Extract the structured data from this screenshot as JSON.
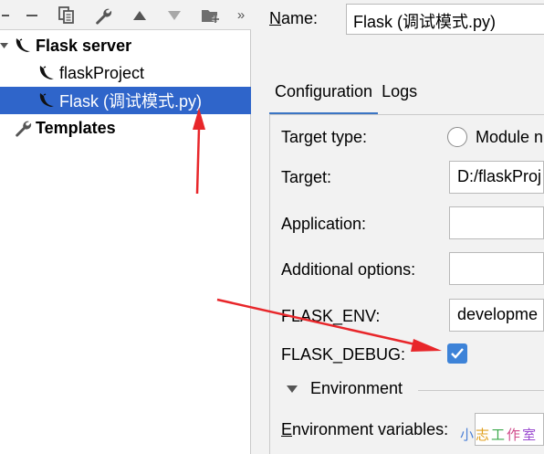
{
  "toolbar": {
    "buttons": [
      "add-icon",
      "remove-icon",
      "copy-icon",
      "wrench-icon",
      "move-up-icon",
      "move-down-icon",
      "new-folder-icon",
      "more-icon"
    ],
    "more_label": "»"
  },
  "tree": {
    "items": [
      {
        "label": "Flask server",
        "level": 0,
        "bold": true,
        "expanded": true,
        "icon": "flask-icon"
      },
      {
        "label": "flaskProject",
        "level": 1,
        "bold": false,
        "icon": "flask-icon"
      },
      {
        "label": "Flask (调试模式.py)",
        "level": 1,
        "bold": false,
        "selected": true,
        "icon": "flask-icon"
      },
      {
        "label": "Templates",
        "level": 0,
        "bold": true,
        "icon": "wrench-icon"
      }
    ]
  },
  "config": {
    "name_label_u": "N",
    "name_label_rest": "ame:",
    "name_value": "Flask (调试模式.py)",
    "tabs": [
      {
        "label": "Configuration",
        "active": true
      },
      {
        "label": "Logs",
        "active": false
      }
    ],
    "target_type_label": "Target type:",
    "target_type_option": "Module n",
    "target_label": "Target:",
    "target_value": "D:/flaskProj",
    "application_label": "Application:",
    "application_value": "",
    "additional_options_label": "Additional options:",
    "additional_options_value": "",
    "flask_env_label": "FLASK_ENV:",
    "flask_env_value": "developme",
    "flask_debug_label": "FLASK_DEBUG:",
    "flask_debug_checked": true,
    "environment_section": "Environment",
    "env_vars_label_u": "E",
    "env_vars_label_rest": "nvironment variables:"
  },
  "watermark": {
    "text": "小志工作室",
    "colors": [
      "#4a7fd6",
      "#e0a020",
      "#3aa84a",
      "#d04a8a",
      "#9a4ad0"
    ]
  },
  "colors": {
    "selection": "#2f65ca",
    "accent": "#3a75c4",
    "checkbox": "#3d83d8",
    "annotation_arrow": "#e8262a"
  }
}
